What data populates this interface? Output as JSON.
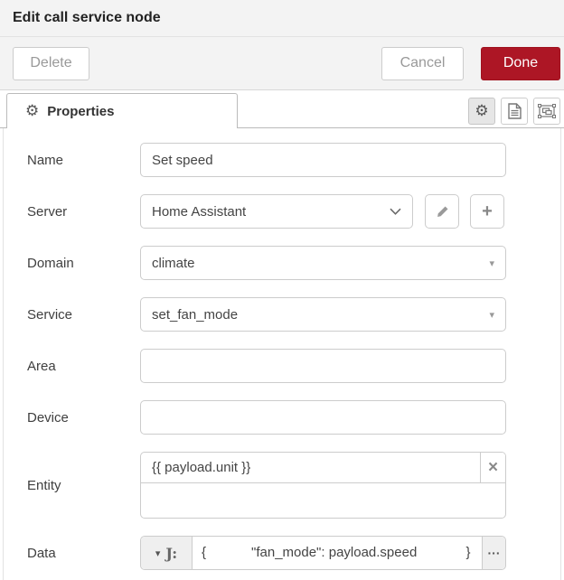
{
  "header": {
    "title": "Edit call service node",
    "delete_label": "Delete",
    "cancel_label": "Cancel",
    "done_label": "Done"
  },
  "tabbar": {
    "properties_label": "Properties"
  },
  "form": {
    "name": {
      "label": "Name",
      "value": "Set speed"
    },
    "server": {
      "label": "Server",
      "value": "Home Assistant"
    },
    "domain": {
      "label": "Domain",
      "value": "climate"
    },
    "service": {
      "label": "Service",
      "value": "set_fan_mode"
    },
    "area": {
      "label": "Area",
      "value": ""
    },
    "device": {
      "label": "Device",
      "value": ""
    },
    "entity": {
      "label": "Entity",
      "value": "{{ payload.unit }}"
    },
    "data": {
      "label": "Data",
      "value": "{            \"fan_mode\": payload.speed             }"
    }
  },
  "icons": {
    "gear": "⚙",
    "caret_down": "▾",
    "remove": "×",
    "plus": "+",
    "jsonata": "J:",
    "ellipsis": "···"
  },
  "colors": {
    "accent_red": "#AD1625",
    "header_bg": "#f3f3f3"
  }
}
